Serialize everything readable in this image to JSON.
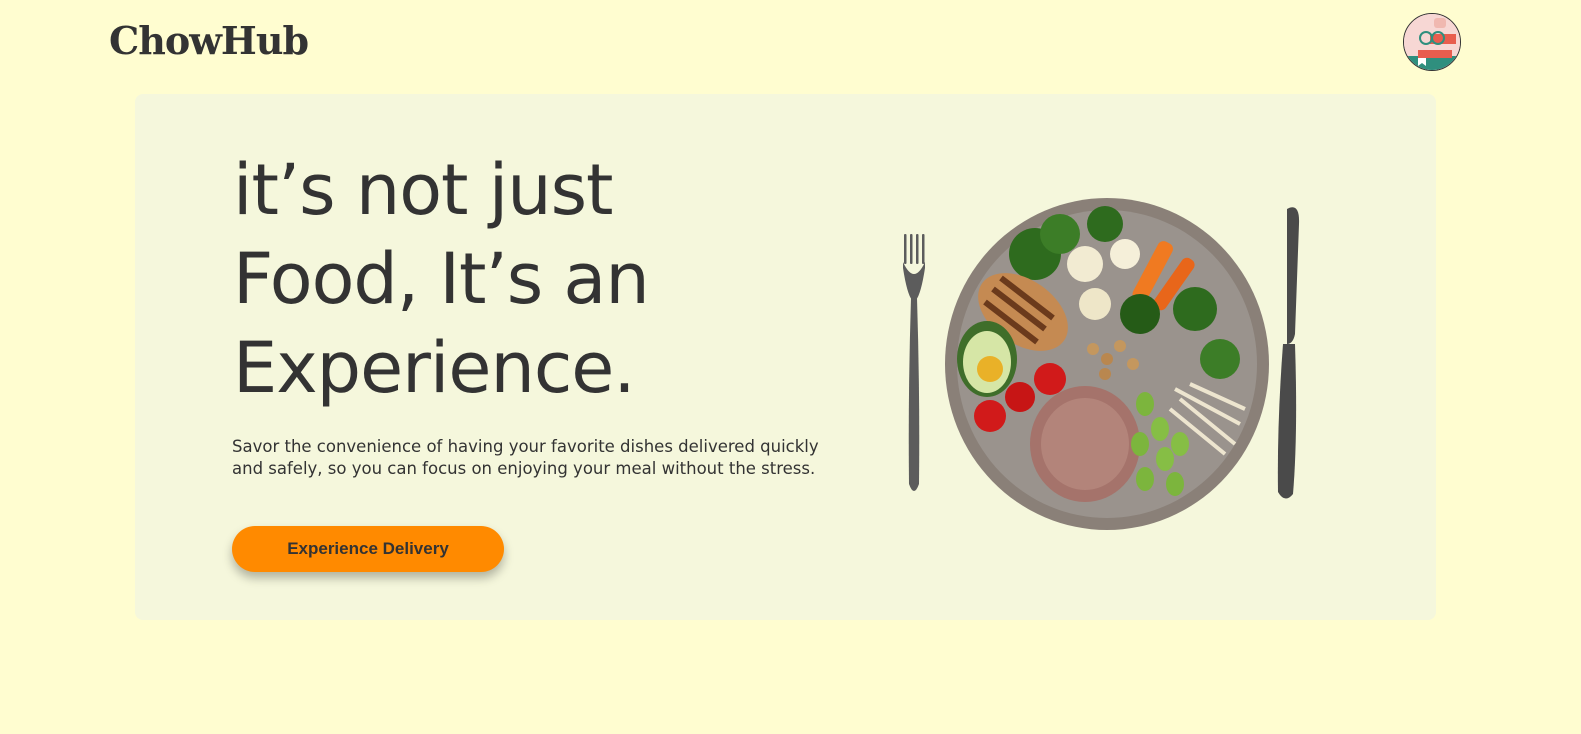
{
  "header": {
    "logo": "ChowHub",
    "avatar_icon": "user-avatar-icon"
  },
  "hero": {
    "headline_lines": [
      "it’s not just",
      "Food, It’s an",
      "Experience."
    ],
    "subtext": "Savor the convenience of having your favorite dishes delivered quickly and safely, so you can focus on enjoying your meal without the stress.",
    "cta_label": "Experience Delivery",
    "image_icon": "plate-with-cutlery-image"
  },
  "colors": {
    "page_background": "#FFFDD0",
    "hero_background": "#F5F7DC",
    "text": "#333333",
    "accent": "#FF8A00"
  }
}
